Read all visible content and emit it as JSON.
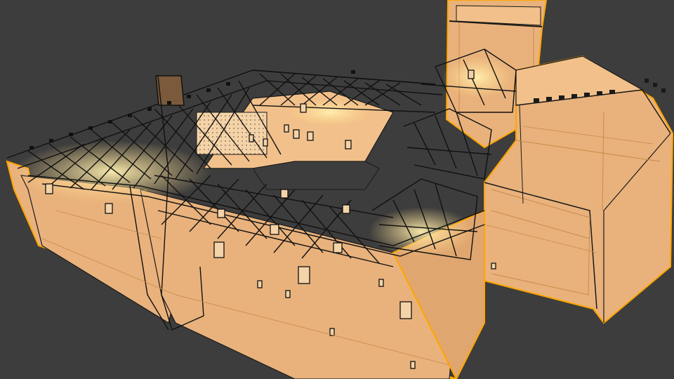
{
  "viewport": {
    "background_color": "#3d3d3d",
    "mode": "wireframe-xray",
    "selection_color": "#ffa500"
  },
  "model": {
    "object_name": "castle",
    "fill_color": "#e9b27c",
    "wire_color": "#111111",
    "highlight_color": "#ffd98a",
    "window_count": 24,
    "battlement_count": 22
  }
}
